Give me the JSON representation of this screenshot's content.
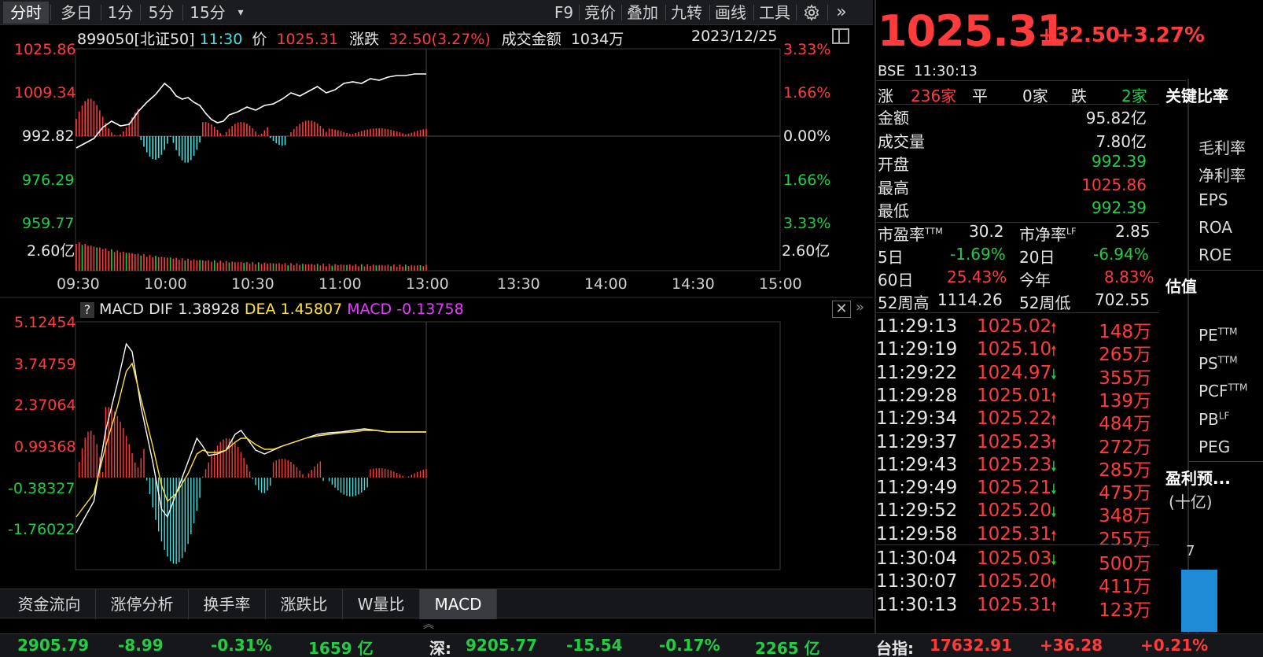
{
  "toolbar": {
    "tabs": [
      "分时",
      "多日",
      "1分",
      "5分",
      "15分"
    ],
    "dropdown": "▾",
    "tools": [
      "F9",
      "竞价",
      "叠加",
      "九转",
      "画线",
      "工具"
    ],
    "settings_icon": "gear-icon",
    "expand_icon": "double-chevron-right-icon"
  },
  "chart": {
    "code": "899050[北证50]",
    "time": "11:30",
    "price_label": "价",
    "price": "1025.31",
    "change_label": "涨跌",
    "change": "32.50(3.27%)",
    "turnover_label": "成交金额",
    "turnover": "1034万",
    "date": "2023/12/25",
    "y_left": [
      "1025.86",
      "1009.34",
      "992.82",
      "976.29",
      "959.77"
    ],
    "y_right": [
      "3.33%",
      "1.66%",
      "0.00%",
      "1.66%",
      "3.33%"
    ],
    "vol_left": "2.60亿",
    "vol_right": "2.60亿",
    "x_times": [
      "09:30",
      "10:00",
      "10:30",
      "11:00",
      "13:00",
      "13:30",
      "14:00",
      "14:30",
      "15:00"
    ],
    "colors": {
      "up": "#ff3b3b",
      "down": "#43e0e0",
      "price_line": "#ffffff",
      "dea": "#ffe13a"
    }
  },
  "macd": {
    "help": "?",
    "label": "MACD",
    "dif_label": "DIF",
    "dif": "1.38928",
    "dea_label": "DEA",
    "dea": "1.45807",
    "macd_label": "MACD",
    "macd": "-0.13758",
    "y_left": [
      "5.12454",
      "3.74759",
      "2.37064",
      "0.99368",
      "-0.38327",
      "-1.76022"
    ]
  },
  "bottom_tabs": [
    "资金流向",
    "涨停分析",
    "换手率",
    "涨跌比",
    "W量比",
    "MACD"
  ],
  "quote": {
    "price": "1025.31",
    "change": "+32.50",
    "pct": "+3.27%",
    "exchange": "BSE",
    "time": "11:30:13",
    "up_label": "涨",
    "up": "236家",
    "flat_label": "平",
    "flat": "0家",
    "down_label": "跌",
    "down": "2家",
    "rows": [
      {
        "label": "金额",
        "value": "95.82亿",
        "color": "white"
      },
      {
        "label": "成交量",
        "value": "7.80亿",
        "color": "white"
      },
      {
        "label": "开盘",
        "value": "992.39",
        "color": "green"
      },
      {
        "label": "最高",
        "value": "1025.86",
        "color": "red"
      },
      {
        "label": "最低",
        "value": "992.39",
        "color": "green"
      }
    ],
    "pe_label": "市盈率",
    "pe_sup": "TTM",
    "pe": "30.2",
    "pb_label": "市净率",
    "pb_sup": "LF",
    "pb": "2.85",
    "d5_label": "5日",
    "d5": "-1.69%",
    "d20_label": "20日",
    "d20": "-6.94%",
    "d60_label": "60日",
    "d60": "25.43%",
    "ytd_label": "今年",
    "ytd": "8.83%",
    "w52h_label": "52周高",
    "w52h": "1114.26",
    "w52l_label": "52周低",
    "w52l": "702.55"
  },
  "ticks": [
    {
      "time": "11:29:13",
      "price": "1025.02",
      "dir": "up",
      "vol": "148万"
    },
    {
      "time": "11:29:19",
      "price": "1025.10",
      "dir": "up",
      "vol": "265万"
    },
    {
      "time": "11:29:22",
      "price": "1024.97",
      "dir": "down",
      "vol": "355万"
    },
    {
      "time": "11:29:28",
      "price": "1025.01",
      "dir": "up",
      "vol": "139万"
    },
    {
      "time": "11:29:34",
      "price": "1025.22",
      "dir": "up",
      "vol": "484万"
    },
    {
      "time": "11:29:37",
      "price": "1025.23",
      "dir": "up",
      "vol": "272万"
    },
    {
      "time": "11:29:43",
      "price": "1025.23",
      "dir": "down",
      "vol": "285万"
    },
    {
      "time": "11:29:49",
      "price": "1025.21",
      "dir": "down",
      "vol": "475万"
    },
    {
      "time": "11:29:52",
      "price": "1025.20",
      "dir": "down",
      "vol": "348万"
    },
    {
      "time": "11:29:58",
      "price": "1025.31",
      "dir": "up",
      "vol": "255万"
    },
    {
      "time": "11:30:04",
      "price": "1025.03",
      "dir": "down",
      "vol": "500万"
    },
    {
      "time": "11:30:07",
      "price": "1025.20",
      "dir": "up",
      "vol": "411万"
    },
    {
      "time": "11:30:13",
      "price": "1025.31",
      "dir": "up",
      "vol": "123万"
    }
  ],
  "ratios": {
    "title": "关键比率",
    "items": [
      "毛利率",
      "净利率",
      "EPS",
      "ROA",
      "ROE"
    ],
    "val_title": "估值",
    "val_items": [
      {
        "name": "PE",
        "sup": "TTM"
      },
      {
        "name": "PS",
        "sup": "TTM"
      },
      {
        "name": "PCF",
        "sup": "TTM"
      },
      {
        "name": "PB",
        "sup": "LF"
      },
      {
        "name": "PEG",
        "sup": ""
      }
    ],
    "forecast_title": "盈利预...",
    "forecast_unit": "(十亿)",
    "forecast_value": "7",
    "forecast_level": 0.79
  },
  "status": [
    {
      "name": "",
      "value": "2905.79",
      "chg": "-8.99",
      "pct": "-0.31%",
      "amt": "1659 亿",
      "color": "green"
    },
    {
      "name": "深:",
      "value": "9205.77",
      "chg": "-15.54",
      "pct": "-0.17%",
      "amt": "2265 亿",
      "color": "green"
    },
    {
      "name": "台指:",
      "value": "17632.91",
      "chg": "+36.28",
      "pct": "+0.21%",
      "amt": "",
      "color": "red"
    }
  ]
}
